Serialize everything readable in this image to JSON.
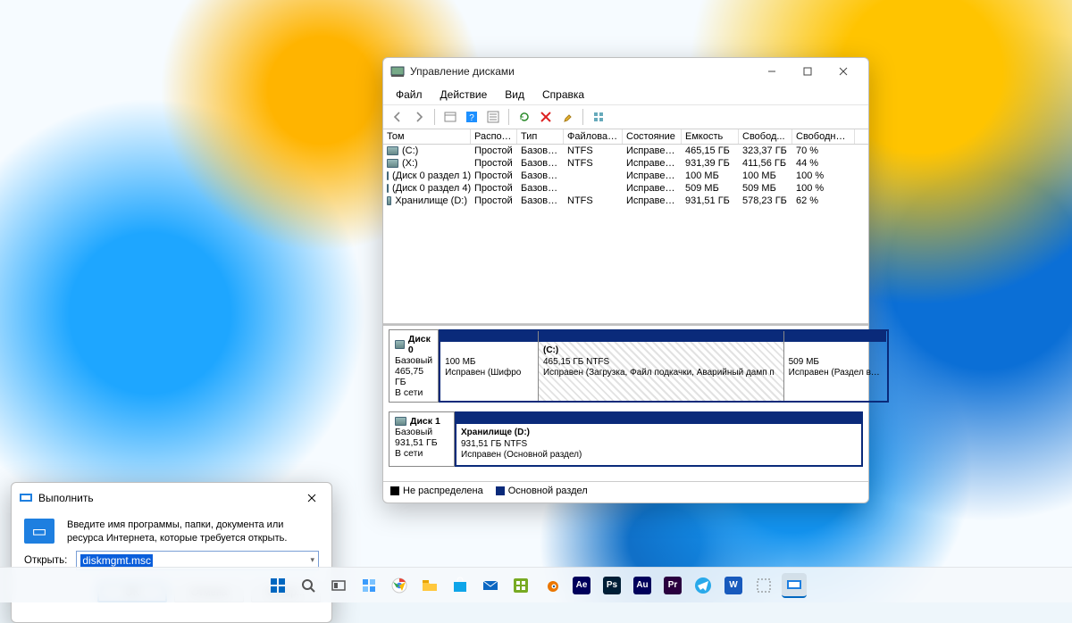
{
  "diskmgmt": {
    "title": "Управление дисками",
    "menu": {
      "file": "Файл",
      "action": "Действие",
      "view": "Вид",
      "help": "Справка"
    },
    "columns": {
      "vol": "Том",
      "layout": "Располо...",
      "type": "Тип",
      "fs": "Файловая с...",
      "status": "Состояние",
      "cap": "Емкость",
      "free": "Свобод...",
      "freepct": "Свободно %"
    },
    "volumes": [
      {
        "name": "(C:)",
        "layout": "Простой",
        "type": "Базовый",
        "fs": "NTFS",
        "status": "Исправен...",
        "cap": "465,15 ГБ",
        "free": "323,37 ГБ",
        "pct": "70 %"
      },
      {
        "name": "(X:)",
        "layout": "Простой",
        "type": "Базовый",
        "fs": "NTFS",
        "status": "Исправен...",
        "cap": "931,39 ГБ",
        "free": "411,56 ГБ",
        "pct": "44 %"
      },
      {
        "name": "(Диск 0 раздел 1)",
        "layout": "Простой",
        "type": "Базовый",
        "fs": "",
        "status": "Исправен...",
        "cap": "100 МБ",
        "free": "100 МБ",
        "pct": "100 %"
      },
      {
        "name": "(Диск 0 раздел 4)",
        "layout": "Простой",
        "type": "Базовый",
        "fs": "",
        "status": "Исправен...",
        "cap": "509 МБ",
        "free": "509 МБ",
        "pct": "100 %"
      },
      {
        "name": "Хранилище (D:)",
        "layout": "Простой",
        "type": "Базовый",
        "fs": "NTFS",
        "status": "Исправен...",
        "cap": "931,51 ГБ",
        "free": "578,23 ГБ",
        "pct": "62 %"
      }
    ],
    "disk0": {
      "label": "Диск 0",
      "type": "Базовый",
      "size": "465,75 ГБ",
      "state": "В сети",
      "parts": [
        {
          "l1": "",
          "l2": "100 МБ",
          "l3": "Исправен (Шифро"
        },
        {
          "l1": "(C:)",
          "l2": "465,15 ГБ NTFS",
          "l3": "Исправен (Загрузка, Файл подкачки, Аварийный дамп п"
        },
        {
          "l1": "",
          "l2": "509 МБ",
          "l3": "Исправен (Раздел восстан"
        }
      ]
    },
    "disk1": {
      "label": "Диск 1",
      "type": "Базовый",
      "size": "931,51 ГБ",
      "state": "В сети",
      "parts": [
        {
          "l1": "Хранилище  (D:)",
          "l2": "931,51 ГБ NTFS",
          "l3": "Исправен (Основной раздел)"
        }
      ]
    },
    "legend": {
      "unalloc": "Не распределена",
      "primary": "Основной раздел"
    }
  },
  "run": {
    "title": "Выполнить",
    "prompt": "Введите имя программы, папки, документа или ресурса Интернета, которые требуется открыть.",
    "open_label": "Открыть:",
    "value": "diskmgmt.msc",
    "ok": "OK",
    "cancel": "Отмена",
    "browse": "Обзор..."
  },
  "taskbar": {
    "items": [
      {
        "name": "start",
        "color": "#0067c0"
      },
      {
        "name": "search",
        "color": "#555"
      },
      {
        "name": "taskview",
        "color": "#555"
      },
      {
        "name": "widgets",
        "color": "#3a9bfc"
      },
      {
        "name": "chrome",
        "color": "#ea4335"
      },
      {
        "name": "explorer",
        "color": "#ffc83d"
      },
      {
        "name": "store",
        "color": "#0ea5e9"
      },
      {
        "name": "mail",
        "color": "#0a66c2"
      },
      {
        "name": "xbox",
        "color": "#107c10"
      },
      {
        "name": "blender",
        "color": "#ea7600"
      },
      {
        "name": "after-effects",
        "label": "Ae",
        "color": "#00005b"
      },
      {
        "name": "photoshop",
        "label": "Ps",
        "color": "#001e36"
      },
      {
        "name": "audition",
        "label": "Au",
        "color": "#00005b"
      },
      {
        "name": "premiere",
        "label": "Pr",
        "color": "#2a003f"
      },
      {
        "name": "telegram",
        "color": "#29a9ea"
      },
      {
        "name": "word",
        "label": "W",
        "color": "#185abd"
      },
      {
        "name": "snip",
        "color": "#777"
      },
      {
        "name": "run",
        "color": "#1e7fe0"
      }
    ]
  }
}
